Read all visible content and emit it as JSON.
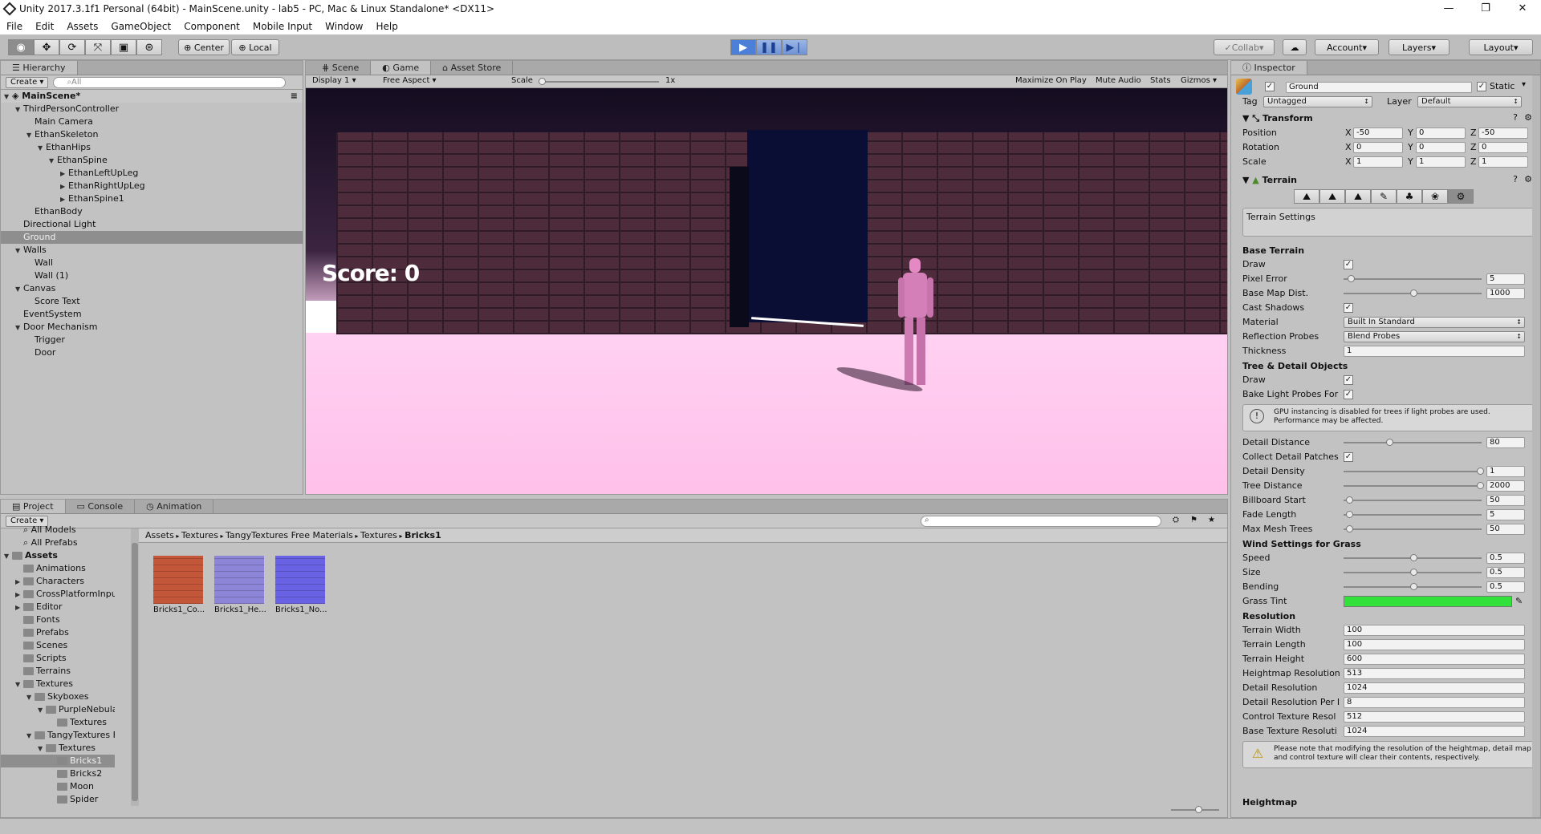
{
  "window": {
    "title": "Unity 2017.3.1f1 Personal (64bit) - MainScene.unity - lab5 - PC, Mac & Linux Standalone* <DX11>",
    "minimize": "—",
    "restore": "❐",
    "close": "✕"
  },
  "menu": [
    "File",
    "Edit",
    "Assets",
    "GameObject",
    "Component",
    "Mobile Input",
    "Window",
    "Help"
  ],
  "toolbar": {
    "pivot": "Center",
    "space": "Local",
    "collab": "Collab",
    "account": "Account",
    "layers": "Layers",
    "layout": "Layout"
  },
  "hierarchy": {
    "tab": "Hierarchy",
    "create": "Create",
    "search_placeholder": "All",
    "scene": "MainScene*",
    "items": [
      {
        "label": "ThirdPersonController",
        "depth": 1,
        "arrow": "▼"
      },
      {
        "label": "Main Camera",
        "depth": 2,
        "arrow": ""
      },
      {
        "label": "EthanSkeleton",
        "depth": 2,
        "arrow": "▼"
      },
      {
        "label": "EthanHips",
        "depth": 3,
        "arrow": "▼"
      },
      {
        "label": "EthanSpine",
        "depth": 4,
        "arrow": "▼"
      },
      {
        "label": "EthanLeftUpLeg",
        "depth": 5,
        "arrow": "▶"
      },
      {
        "label": "EthanRightUpLeg",
        "depth": 5,
        "arrow": "▶"
      },
      {
        "label": "EthanSpine1",
        "depth": 5,
        "arrow": "▶"
      },
      {
        "label": "EthanBody",
        "depth": 2,
        "arrow": ""
      },
      {
        "label": "Directional Light",
        "depth": 1,
        "arrow": ""
      },
      {
        "label": "Ground",
        "depth": 1,
        "arrow": "",
        "selected": true
      },
      {
        "label": "Walls",
        "depth": 1,
        "arrow": "▼"
      },
      {
        "label": "Wall",
        "depth": 2,
        "arrow": ""
      },
      {
        "label": "Wall (1)",
        "depth": 2,
        "arrow": ""
      },
      {
        "label": "Canvas",
        "depth": 1,
        "arrow": "▼"
      },
      {
        "label": "Score Text",
        "depth": 2,
        "arrow": ""
      },
      {
        "label": "EventSystem",
        "depth": 1,
        "arrow": ""
      },
      {
        "label": "Door Mechanism",
        "depth": 1,
        "arrow": "▼"
      },
      {
        "label": "Trigger",
        "depth": 2,
        "arrow": ""
      },
      {
        "label": "Door",
        "depth": 2,
        "arrow": ""
      }
    ]
  },
  "game": {
    "tabs": [
      "Scene",
      "Game",
      "Asset Store"
    ],
    "display": "Display 1",
    "aspect": "Free Aspect",
    "scale_label": "Scale",
    "scale_value": "1x",
    "maximize": "Maximize On Play",
    "mute": "Mute Audio",
    "stats": "Stats",
    "gizmos": "Gizmos",
    "score": "Score: 0"
  },
  "project": {
    "tabs": [
      "Project",
      "Console",
      "Animation"
    ],
    "create": "Create",
    "breadcrumb": [
      "Assets",
      "Textures",
      "TangyTextures Free Materials",
      "Textures",
      "Bricks1"
    ],
    "folders": [
      {
        "label": "All Models",
        "depth": 1,
        "type": "search"
      },
      {
        "label": "All Prefabs",
        "depth": 1,
        "type": "search"
      },
      {
        "label": "Assets",
        "depth": 0,
        "type": "folder",
        "arrow": "▼",
        "bold": true
      },
      {
        "label": "Animations",
        "depth": 1,
        "type": "folder",
        "arrow": ""
      },
      {
        "label": "Characters",
        "depth": 1,
        "type": "folder",
        "arrow": "▶"
      },
      {
        "label": "CrossPlatformInput",
        "depth": 1,
        "type": "folder",
        "arrow": "▶"
      },
      {
        "label": "Editor",
        "depth": 1,
        "type": "folder",
        "arrow": "▶"
      },
      {
        "label": "Fonts",
        "depth": 1,
        "type": "folder",
        "arrow": ""
      },
      {
        "label": "Prefabs",
        "depth": 1,
        "type": "folder",
        "arrow": ""
      },
      {
        "label": "Scenes",
        "depth": 1,
        "type": "folder",
        "arrow": ""
      },
      {
        "label": "Scripts",
        "depth": 1,
        "type": "folder",
        "arrow": ""
      },
      {
        "label": "Terrains",
        "depth": 1,
        "type": "folder",
        "arrow": ""
      },
      {
        "label": "Textures",
        "depth": 1,
        "type": "folder",
        "arrow": "▼"
      },
      {
        "label": "Skyboxes",
        "depth": 2,
        "type": "folder",
        "arrow": "▼"
      },
      {
        "label": "PurpleNebula",
        "depth": 3,
        "type": "folder",
        "arrow": "▼"
      },
      {
        "label": "Textures",
        "depth": 4,
        "type": "folder",
        "arrow": ""
      },
      {
        "label": "TangyTextures Fr",
        "depth": 2,
        "type": "folder",
        "arrow": "▼"
      },
      {
        "label": "Textures",
        "depth": 3,
        "type": "folder",
        "arrow": "▼"
      },
      {
        "label": "Bricks1",
        "depth": 4,
        "type": "folder",
        "arrow": "",
        "selected": true
      },
      {
        "label": "Bricks2",
        "depth": 4,
        "type": "folder",
        "arrow": ""
      },
      {
        "label": "Moon",
        "depth": 4,
        "type": "folder",
        "arrow": ""
      },
      {
        "label": "Spider",
        "depth": 4,
        "type": "folder",
        "arrow": ""
      }
    ],
    "assets": [
      {
        "label": "Bricks1_Co...",
        "color": "#c4573a"
      },
      {
        "label": "Bricks1_He...",
        "color": "#8d86d8"
      },
      {
        "label": "Bricks1_No...",
        "color": "#6a62e4"
      }
    ]
  },
  "inspector": {
    "tab": "Inspector",
    "name": "Ground",
    "static": "Static",
    "tag_label": "Tag",
    "tag": "Untagged",
    "layer_label": "Layer",
    "layer": "Default",
    "transform": {
      "title": "Transform",
      "rows": [
        {
          "label": "Position",
          "x": "-50",
          "y": "0",
          "z": "-50"
        },
        {
          "label": "Rotation",
          "x": "0",
          "y": "0",
          "z": "0"
        },
        {
          "label": "Scale",
          "x": "1",
          "y": "1",
          "z": "1"
        }
      ]
    },
    "terrain": {
      "title": "Terrain",
      "settings_label": "Terrain Settings",
      "base_title": "Base Terrain",
      "draw": "Draw",
      "pixel_error": "Pixel Error",
      "pixel_error_val": "5",
      "base_map_dist": "Base Map Dist.",
      "base_map_dist_val": "1000",
      "cast_shadows": "Cast Shadows",
      "material": "Material",
      "material_val": "Built In Standard",
      "reflection": "Reflection Probes",
      "reflection_val": "Blend Probes",
      "thickness": "Thickness",
      "thickness_val": "1",
      "tree_title": "Tree & Detail Objects",
      "tree_draw": "Draw",
      "bake": "Bake Light Probes For",
      "gpu_note": "GPU instancing is disabled for trees if light probes are used. Performance may be affected.",
      "detail_distance": "Detail Distance",
      "detail_distance_val": "80",
      "collect": "Collect Detail Patches",
      "detail_density": "Detail Density",
      "detail_density_val": "1",
      "tree_distance": "Tree Distance",
      "tree_distance_val": "2000",
      "billboard": "Billboard Start",
      "billboard_val": "50",
      "fade": "Fade Length",
      "fade_val": "5",
      "max_mesh": "Max Mesh Trees",
      "max_mesh_val": "50",
      "wind_title": "Wind Settings for Grass",
      "speed": "Speed",
      "speed_val": "0.5",
      "size": "Size",
      "size_val": "0.5",
      "bending": "Bending",
      "bending_val": "0.5",
      "grass_tint": "Grass Tint",
      "grass_color": "#33e13b",
      "res_title": "Resolution",
      "tw": "Terrain Width",
      "tw_val": "100",
      "tl": "Terrain Length",
      "tl_val": "100",
      "th": "Terrain Height",
      "th_val": "600",
      "hr": "Heightmap Resolution",
      "hr_val": "513",
      "dr": "Detail Resolution",
      "dr_val": "1024",
      "drp": "Detail Resolution Per I",
      "drp_val": "8",
      "ctr": "Control Texture Resol",
      "ctr_val": "512",
      "btr": "Base Texture Resoluti",
      "btr_val": "1024",
      "warn": "Please note that modifying the resolution of the heightmap, detail map and control texture will clear their contents, respectively.",
      "heightmap": "Heightmap"
    }
  }
}
